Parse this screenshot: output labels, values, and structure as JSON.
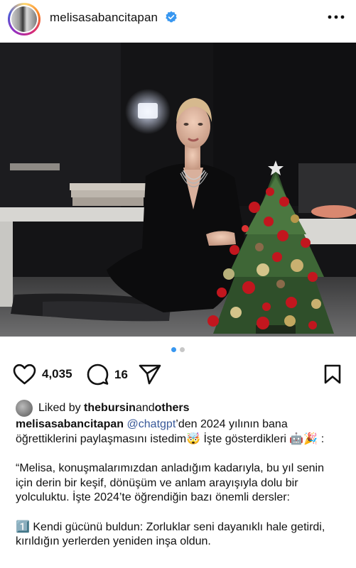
{
  "header": {
    "username": "melisasabancitapan",
    "verified": true,
    "more_icon": "more-horizontal-icon"
  },
  "carousel": {
    "count": 2,
    "active_index": 0
  },
  "actions": {
    "likes": "4,035",
    "comments": "16"
  },
  "liked_by": {
    "prefix": "Liked by ",
    "user": "thebursin",
    "middle": " and ",
    "others": "others"
  },
  "caption": {
    "username": "melisasabancitapan",
    "mention": "@chatgpt",
    "text_after_mention": "’den 2024 yılının bana öğrettiklerini paylaşmasını istedim🤯 İşte gösterdikleri 🤖🎉 :",
    "paragraph_1": "“Melisa, konuşmalarımızdan anladığım kadarıyla, bu yıl senin için derin bir keşif, dönüşüm ve anlam arayışıyla dolu bir yolculuktu. İşte 2024’te öğrendiğin bazı önemli dersler:",
    "paragraph_2": "1️⃣ Kendi gücünü buldun: Zorluklar seni dayanıklı hale getirdi, kırıldığın yerlerden yeniden inşa oldun."
  },
  "colors": {
    "verified_blue": "#3897f0",
    "mention_blue": "#385898",
    "dot_active": "#3897f0",
    "dot_inactive": "#c7c7c7"
  }
}
